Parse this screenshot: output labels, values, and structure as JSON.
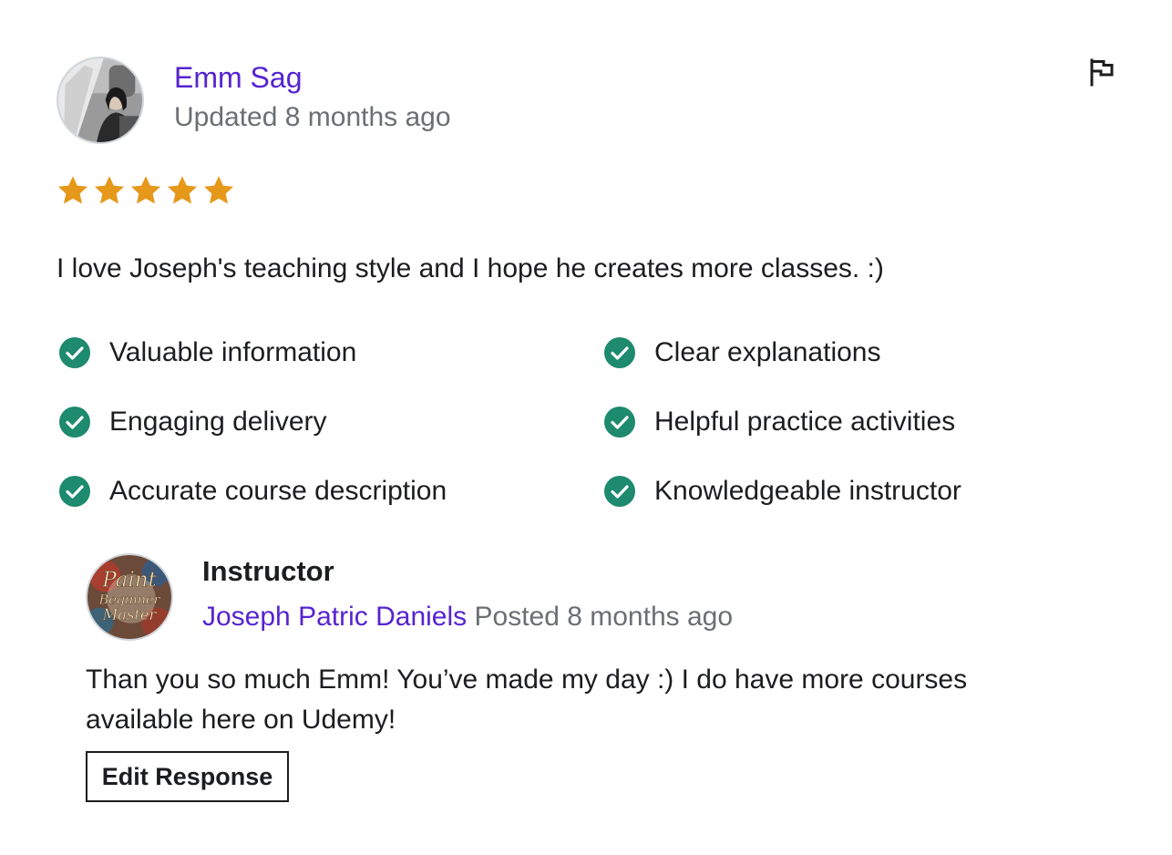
{
  "review": {
    "author_name": "Emm Sag",
    "updated": "Updated 8 months ago",
    "rating": 5,
    "rating_max": 5,
    "text": "I love Joseph's teaching style and I hope he creates more classes. :)",
    "star_color": "#e59819",
    "flag_icon": "flag-icon"
  },
  "feedback": [
    {
      "label": "Valuable information"
    },
    {
      "label": "Clear explanations"
    },
    {
      "label": "Engaging delivery"
    },
    {
      "label": "Helpful practice activities"
    },
    {
      "label": "Accurate course description"
    },
    {
      "label": "Knowledgeable instructor"
    }
  ],
  "response": {
    "role": "Instructor",
    "instructor_name": "Joseph Patric Daniels",
    "posted": "Posted 8 months ago",
    "text": "Than you so much Emm! You’ve made my day :) I do have more courses available here on Udemy!",
    "avatar_text": [
      "Paint",
      "Beginner",
      "Master"
    ],
    "edit_button": "Edit Response"
  },
  "colors": {
    "link": "#5624d0",
    "muted": "#6a6f73",
    "text": "#1c1d1f",
    "check": "#1e8a6e"
  }
}
